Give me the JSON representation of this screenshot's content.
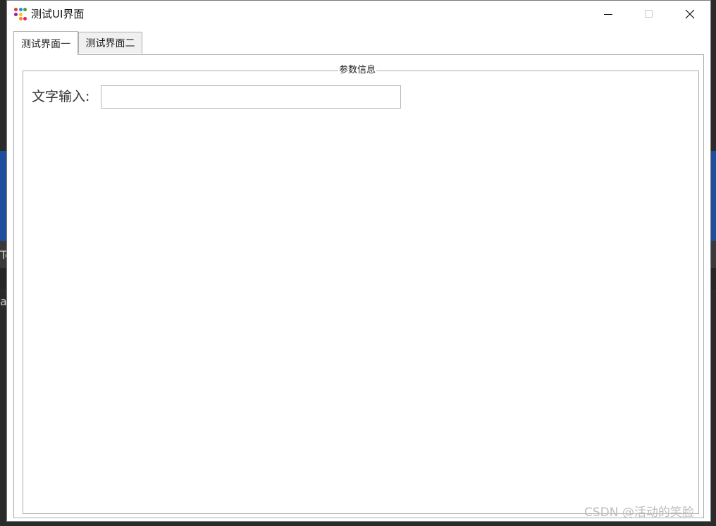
{
  "background": {
    "text_1": "Te",
    "text_2": "a"
  },
  "window": {
    "title": "测试UI界面",
    "icons": {
      "app": "app-dots-icon",
      "minimize": "minimize-icon",
      "maximize": "maximize-icon",
      "close": "close-icon"
    }
  },
  "tabs": [
    {
      "label": "测试界面一",
      "active": true
    },
    {
      "label": "测试界面二",
      "active": false
    }
  ],
  "groupbox": {
    "title": "参数信息",
    "field_label": "文字输入:",
    "input_value": "",
    "input_placeholder": ""
  },
  "watermark": "CSDN @活动的笑脸",
  "colors": {
    "background_accent": "#1f4e9e",
    "window_bg": "#ffffff",
    "border": "#adadad"
  }
}
